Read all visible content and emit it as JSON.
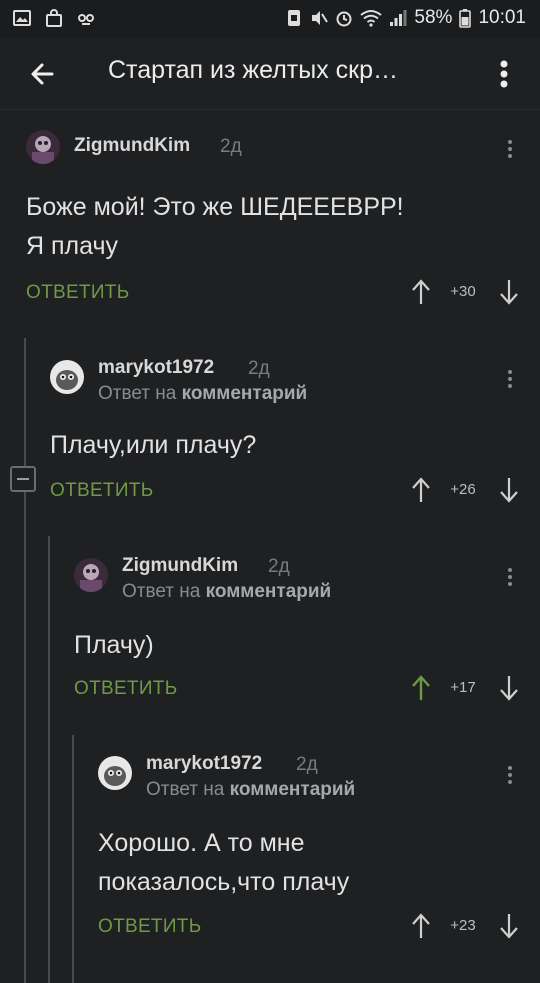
{
  "status_bar": {
    "battery": "58%",
    "time": "10:01"
  },
  "app_bar": {
    "title": "Стартап из желтых скр…"
  },
  "comments": [
    {
      "user": "ZigmundKim",
      "time": "2д",
      "reply_prefix": "",
      "reply_target": "",
      "text_lines": [
        "Боже мой! Это же ШЕДЕЕЕВРР!",
        "Я плачу"
      ],
      "reply_label": "ОТВЕТИТЬ",
      "score": "+30",
      "upvoted": false
    },
    {
      "user": "marykot1972",
      "time": "2д",
      "reply_prefix": "Ответ на ",
      "reply_target": "комментарий",
      "text_lines": [
        "Плачу,или плачу?"
      ],
      "reply_label": "ОТВЕТИТЬ",
      "score": "+26",
      "upvoted": false
    },
    {
      "user": "ZigmundKim",
      "time": "2д",
      "reply_prefix": "Ответ на ",
      "reply_target": "комментарий",
      "text_lines": [
        "Плачу)"
      ],
      "reply_label": "ОТВЕТИТЬ",
      "score": "+17",
      "upvoted": true
    },
    {
      "user": "marykot1972",
      "time": "2д",
      "reply_prefix": "Ответ на ",
      "reply_target": "комментарий",
      "text_lines": [
        "Хорошо. А то мне",
        "показалось,что плачу"
      ],
      "reply_label": "ОТВЕТИТЬ",
      "score": "+23",
      "upvoted": false
    }
  ],
  "colors": {
    "background": "#1f2022",
    "accent_green": "#6f9a45",
    "text": "#e2e2e2",
    "muted": "#8a8b8e"
  }
}
